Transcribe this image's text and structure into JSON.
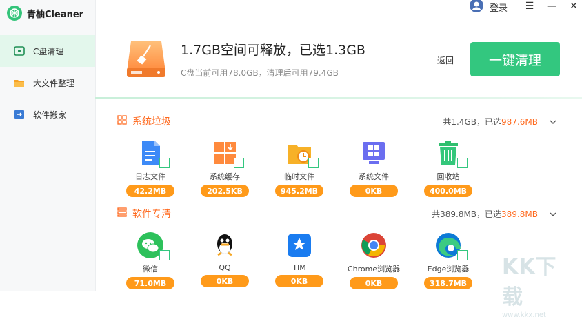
{
  "app": {
    "title": "青柚Cleaner"
  },
  "window": {
    "login_label": "登录",
    "menu_glyph": "☰",
    "minimize_glyph": "—",
    "close_glyph": "✕"
  },
  "sidebar": {
    "items": [
      {
        "label": "C盘清理",
        "icon": "drive-icon",
        "active": true
      },
      {
        "label": "大文件整理",
        "icon": "folder-icon",
        "active": false
      },
      {
        "label": "软件搬家",
        "icon": "move-app-icon",
        "active": false
      }
    ]
  },
  "hero": {
    "title": "1.7GB空间可释放，已选1.3GB",
    "subtitle": "C盘当前可用78.0GB，清理后可用79.4GB",
    "back_label": "返回",
    "clean_label": "一键清理"
  },
  "sections": [
    {
      "title": "系统垃圾",
      "summary_prefix": "共1.4GB，已选",
      "summary_value": "987.6MB",
      "items": [
        {
          "label": "日志文件",
          "size": "42.2MB",
          "icon": "log-file-icon"
        },
        {
          "label": "系统缓存",
          "size": "202.5KB",
          "icon": "system-cache-icon"
        },
        {
          "label": "临时文件",
          "size": "945.2MB",
          "icon": "temp-folder-icon"
        },
        {
          "label": "系统文件",
          "size": "0KB",
          "icon": "system-file-icon"
        },
        {
          "label": "回收站",
          "size": "400.0MB",
          "icon": "recycle-bin-icon"
        }
      ]
    },
    {
      "title": "软件专清",
      "summary_prefix": "共389.8MB，已选",
      "summary_value": "389.8MB",
      "items": [
        {
          "label": "微信",
          "size": "71.0MB",
          "icon": "wechat-icon"
        },
        {
          "label": "QQ",
          "size": "0KB",
          "icon": "qq-icon"
        },
        {
          "label": "TIM",
          "size": "0KB",
          "icon": "tim-icon"
        },
        {
          "label": "Chrome浏览器",
          "size": "0KB",
          "icon": "chrome-icon"
        },
        {
          "label": "Edge浏览器",
          "size": "318.7MB",
          "icon": "edge-icon"
        }
      ]
    }
  ],
  "colors": {
    "accent": "#33c77f",
    "orange": "#ff6a1f",
    "pill": "#ff9a1a"
  },
  "watermark": {
    "text": "KK下载",
    "url_text": "www.kkx.net"
  }
}
